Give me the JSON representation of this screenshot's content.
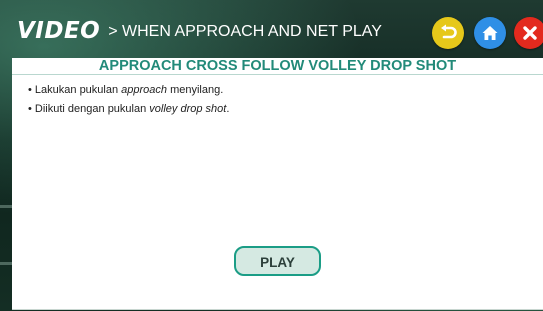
{
  "header": {
    "brand": "VIDEO",
    "title": "> WHEN APPROACH AND NET PLAY",
    "icons": {
      "back": "back-arrow-icon",
      "home": "home-icon",
      "close": "close-icon"
    },
    "colors": {
      "back": "#e6c81a",
      "home": "#2f8fe6",
      "close": "#e32a1e"
    }
  },
  "panel": {
    "heading": "APPROACH CROSS FOLLOW VOLLEY DROP SHOT",
    "bullets": [
      {
        "marker": "•",
        "before": "Lakukan pukulan ",
        "emphasis": "approach",
        "after": " menyilang."
      },
      {
        "marker": "•",
        "before": "Diikuti dengan pukulan ",
        "emphasis": "volley drop shot",
        "after": "."
      }
    ],
    "play_label": "PLAY",
    "accent_color": "#228a79"
  }
}
